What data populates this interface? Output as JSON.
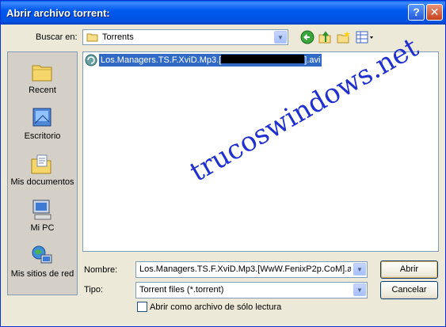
{
  "window": {
    "title": "Abrir archivo torrent:",
    "help_label": "?",
    "close_label": "✕"
  },
  "lookin": {
    "label": "Buscar en:",
    "value": "Torrents"
  },
  "toolbar": {
    "icons": [
      "back-icon",
      "up-folder-icon",
      "new-folder-icon",
      "view-menu-icon"
    ]
  },
  "places": [
    {
      "label": "Recent",
      "icon": "recent-icon"
    },
    {
      "label": "Escritorio",
      "icon": "desktop-icon"
    },
    {
      "label": "Mis documentos",
      "icon": "my-documents-icon"
    },
    {
      "label": "Mi PC",
      "icon": "my-computer-icon"
    },
    {
      "label": "Mis sitios de red",
      "icon": "network-places-icon"
    }
  ],
  "files": [
    {
      "name_start": "Los.Managers.TS.F.XviD.Mp3.[",
      "name_end": "].avi",
      "icon": "torrent-file-icon",
      "selected": true
    }
  ],
  "watermark": "trucoswindows.net",
  "filename": {
    "label": "Nombre:",
    "value": "Los.Managers.TS.F.XviD.Mp3.[WwW.FenixP2p.CoM].av"
  },
  "filetype": {
    "label": "Tipo:",
    "value": "Torrent files (*.torrent)"
  },
  "readonly": {
    "label": "Abrir como archivo de sólo lectura",
    "checked": false
  },
  "buttons": {
    "open": "Abrir",
    "cancel": "Cancelar"
  },
  "colors": {
    "titlebar": "#0058ee",
    "selection": "#316ac5",
    "watermark": "#1f2fd0"
  }
}
